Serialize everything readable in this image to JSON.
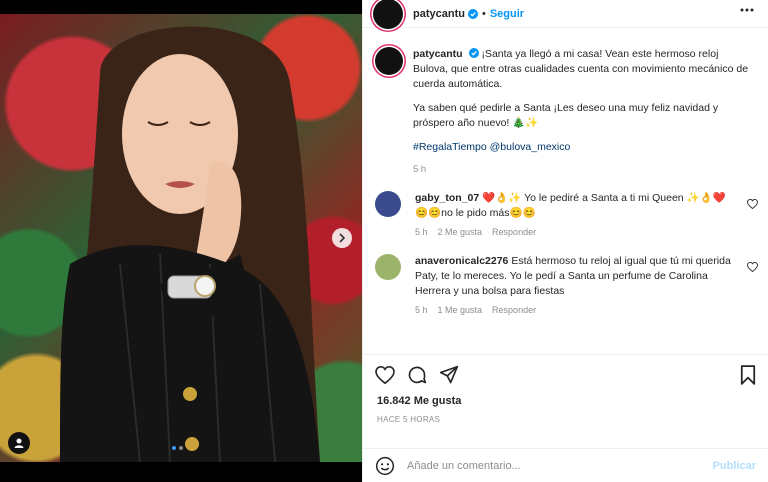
{
  "post": {
    "username": "patycantu",
    "follow_label": "Seguir",
    "header_separator": "•",
    "caption": {
      "text_1": "¡Santa ya llegó a mi casa! Vean este hermoso reloj Bulova, que entre otras cualidades cuenta con movimiento mecánico de cuerda automática.",
      "text_2": "Ya saben qué pedirle a Santa ¡Les deseo una muy feliz navidad y próspero año nuevo! 🎄✨",
      "hashtags": "#RegalaTiempo @bulova_mexico",
      "time": "5 h"
    },
    "comments": [
      {
        "username": "gaby_ton_07",
        "text": "❤️👌✨ Yo le pediré a Santa a ti mi Queen ✨👌❤️😊😊no le pido más😊😊",
        "time": "5 h",
        "likes": "2 Me gusta",
        "reply": "Responder",
        "avatar_color": "#3a4a8a"
      },
      {
        "username": "anaveronicalc2276",
        "text": "Está hermoso tu reloj al igual que tú mi querida Paty, te lo mereces. Yo le pedí a Santa un perfume de Carolina Herrera y una bolsa para fiestas",
        "time": "5 h",
        "likes": "1 Me gusta",
        "reply": "Responder",
        "avatar_color": "#9bb36a"
      }
    ],
    "likes": "16.842 Me gusta",
    "ago": "HACE 5 HORAS",
    "comment_placeholder": "Añade un comentario...",
    "publish_label": "Publicar",
    "carousel": {
      "count": 2,
      "active": 1
    }
  },
  "icons": {
    "verified": "verified-badge-icon",
    "more": "more-options-icon",
    "heart": "heart-icon",
    "comment": "comment-icon",
    "share": "share-icon",
    "save": "bookmark-icon",
    "emoji": "emoji-icon",
    "next": "chevron-right-icon",
    "tag": "user-tag-icon"
  },
  "colors": {
    "accent": "#0095f6",
    "publish_disabled": "#b2dffc",
    "story_ring": "#e1306c",
    "muted": "#8e8e8e"
  }
}
